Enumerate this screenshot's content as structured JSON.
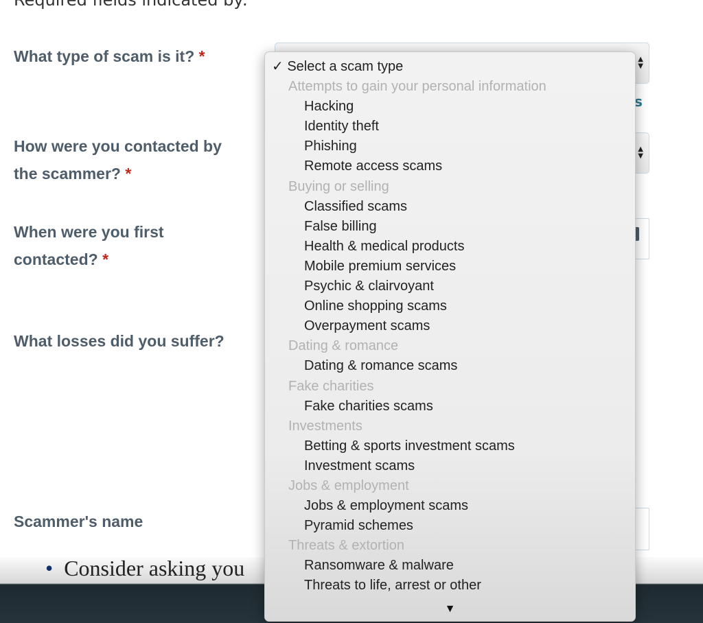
{
  "required_note": "Required fields indicated by:",
  "form": {
    "scam_type_label": "What type of scam is it?",
    "contact_label_1": "How were you contacted by",
    "contact_label_2": "the scammer?",
    "first_contact_label_1": "When were you first",
    "first_contact_label_2": "contacted?",
    "losses_label": "What losses did you suffer?",
    "scammer_name_label": "Scammer's name",
    "required_marker": "*",
    "link_fragment": "s"
  },
  "background_text": "Consider asking you",
  "dropdown": {
    "selected": "Select a scam type",
    "check": "✓",
    "groups": [
      {
        "label": "Attempts to gain your personal information",
        "items": [
          "Hacking",
          "Identity theft",
          "Phishing",
          "Remote access scams"
        ]
      },
      {
        "label": "Buying or selling",
        "items": [
          "Classified scams",
          "False billing",
          "Health & medical products",
          "Mobile premium services",
          "Psychic & clairvoyant",
          "Online shopping scams",
          "Overpayment scams"
        ]
      },
      {
        "label": "Dating & romance",
        "items": [
          "Dating & romance scams"
        ]
      },
      {
        "label": "Fake charities",
        "items": [
          "Fake charities scams"
        ]
      },
      {
        "label": "Investments",
        "items": [
          "Betting & sports investment scams",
          "Investment scams"
        ]
      },
      {
        "label": "Jobs & employment",
        "items": [
          "Jobs & employment scams",
          "Pyramid schemes"
        ]
      },
      {
        "label": "Threats & extortion",
        "items": [
          "Ransomware & malware",
          "Threats to life, arrest or other"
        ]
      }
    ],
    "scroll_down": "▼"
  }
}
